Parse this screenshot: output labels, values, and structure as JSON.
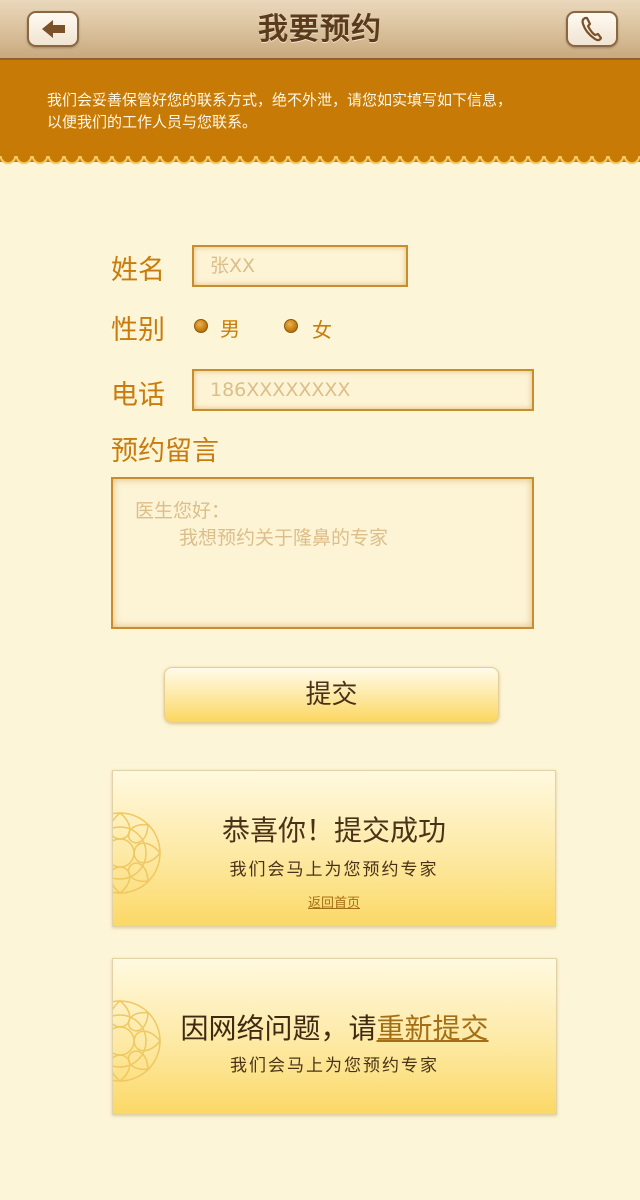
{
  "header": {
    "title": "我要预约",
    "back_icon": "back-arrow-icon",
    "call_icon": "phone-icon"
  },
  "notice": {
    "line1": "我们会妥善保管好您的联系方式，绝不外泄，请您如实填写如下信息，",
    "line2": "以便我们的工作人员与您联系。"
  },
  "form": {
    "name_label": "姓名",
    "name_placeholder": "张XX",
    "gender_label": "性别",
    "gender_options": [
      "男",
      "女"
    ],
    "phone_label": "电话",
    "phone_placeholder": "186XXXXXXXX",
    "message_label": "预约留言",
    "message_placeholder_line1": "医生您好：",
    "message_placeholder_line2": "我想预约关于隆鼻的专家",
    "submit_label": "提交"
  },
  "success_card": {
    "title": "恭喜你！提交成功",
    "subtitle": "我们会马上为您预约专家",
    "link": "返回首页"
  },
  "error_card": {
    "title_prefix": "因网络问题，请",
    "retry_link": "重新提交",
    "subtitle": "我们会马上为您预约专家"
  },
  "colors": {
    "background": "#fdf5d8",
    "banner": "#c77b06",
    "label": "#c97c0d",
    "input_border": "#c88d2f"
  }
}
